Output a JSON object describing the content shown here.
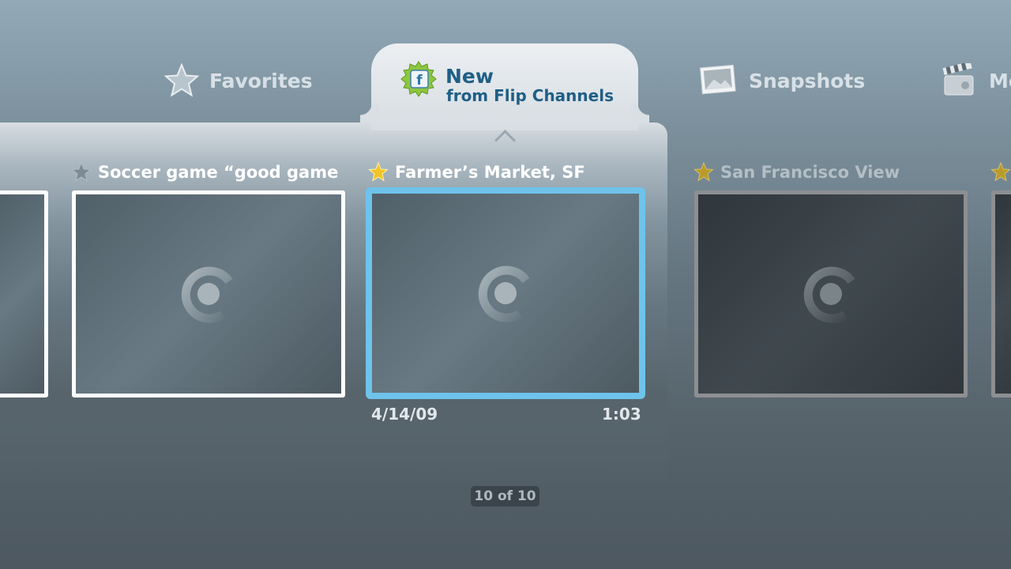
{
  "tabs": {
    "favorites": "Favorites",
    "new_title": "New",
    "new_subtitle": "from Flip Channels",
    "snapshots": "Snapshots",
    "movies": "Mo"
  },
  "items": [
    {
      "title": "",
      "starred": false
    },
    {
      "title": "Soccer game “good game” ri",
      "starred": false
    },
    {
      "title": "Farmer’s Market, SF",
      "starred": true,
      "date": "4/14/09",
      "duration": "1:03"
    },
    {
      "title": "San Francisco View",
      "starred": true
    },
    {
      "title": "",
      "starred": true
    }
  ],
  "counter": "10 of 10",
  "colors": {
    "accent": "#6ec3ea",
    "selected_tab_text": "#1f5f86",
    "star_gold": "#f2c322"
  },
  "icons": {
    "favorites": "star-outline-icon",
    "new": "flip-channel-badge-icon",
    "snapshots": "photo-icon",
    "movies": "clapperboard-icon",
    "loading": "spinner-icon"
  }
}
